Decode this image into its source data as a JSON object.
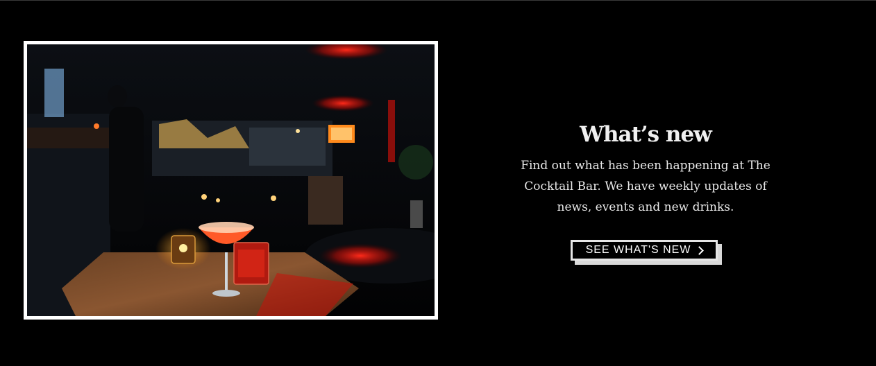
{
  "section": {
    "title": "What’s new",
    "description": "Find out what has been happening at The Cocktail Bar. We have weekly updates of news, events and new drinks.",
    "cta_label": "SEE WHAT'S NEW",
    "cta_icon": "chevron-right-icon"
  },
  "photo": {
    "subject": "bar-interior-cocktail-photo"
  },
  "colors": {
    "background": "#000000",
    "frame": "#ffffff",
    "accent_red": "#ff1a10",
    "button_shadow": "#d9d9d9"
  }
}
